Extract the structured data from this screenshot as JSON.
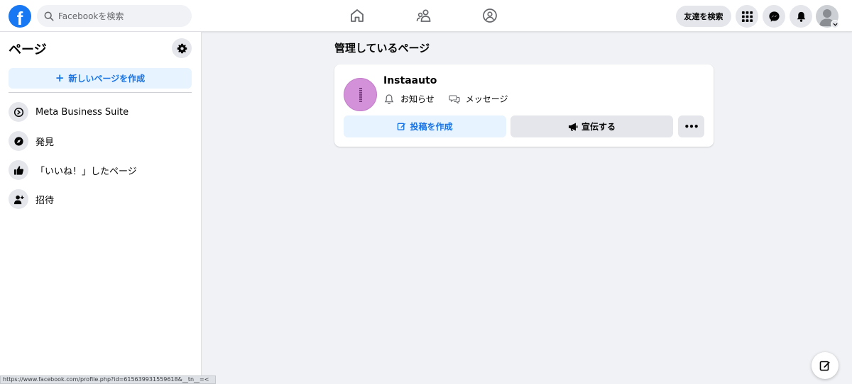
{
  "topbar": {
    "logo_letter": "f",
    "search_placeholder": "Facebookを検索",
    "find_friends_label": "友達を検索"
  },
  "sidebar": {
    "title": "ページ",
    "create_button_label": "新しいページを作成",
    "items": [
      {
        "label": "Meta Business Suite",
        "icon": "meta-business-suite-icon"
      },
      {
        "label": "発見",
        "icon": "compass-icon"
      },
      {
        "label": "「いいね！」したページ",
        "icon": "thumbs-up-icon"
      },
      {
        "label": "招待",
        "icon": "add-person-icon"
      }
    ]
  },
  "main": {
    "title": "管理しているページ",
    "page_card": {
      "name": "Instaauto",
      "notifications_label": "お知らせ",
      "messages_label": "メッセージ",
      "create_post_label": "投稿を作成",
      "promote_label": "宣伝する",
      "more_label": "•••"
    }
  },
  "statusbar": {
    "url": "https://www.facebook.com/profile.php?id=615639931559618&__tn__=<"
  },
  "colors": {
    "brand": "#1877f2",
    "accent_text": "#1b74e4",
    "accent_bg": "#e7f3ff",
    "page_avatar": "#d291d8",
    "background": "#f0f2f5"
  }
}
